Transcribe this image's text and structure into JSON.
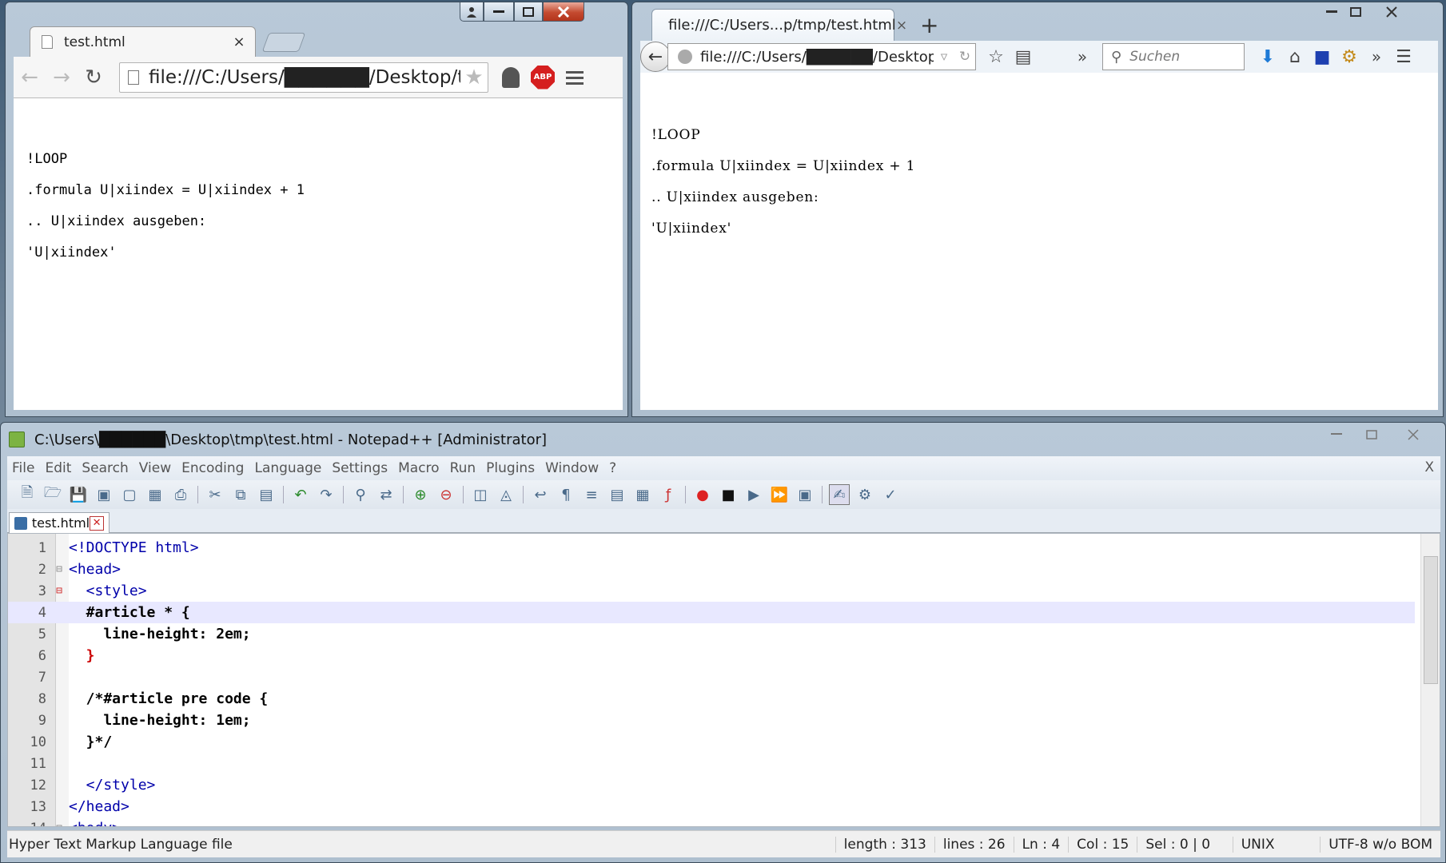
{
  "chrome": {
    "tab_title": "test.html",
    "tab_close": "×",
    "url": "file:///C:/Users/██████/Desktop/tmp",
    "abp_label": "ABP",
    "content_lines": [
      "!LOOP",
      ".formula U|xiindex = U|xiindex + 1",
      ".. U|xiindex ausgeben:",
      "'U|xiindex'"
    ]
  },
  "firefox": {
    "tab_title": "file:///C:/Users...p/tmp/test.html",
    "tab_close": "×",
    "new_tab": "+",
    "url": "file:///C:/Users/██████/Desktop/tm",
    "search_placeholder": "Suchen",
    "overflow": "»",
    "content_lines": [
      "!LOOP",
      ".formula U|xiindex = U|xiindex + 1",
      ".. U|xiindex ausgeben:",
      "'U|xiindex'"
    ]
  },
  "notepad": {
    "title": "C:\\Users\\██████\\Desktop\\tmp\\test.html - Notepad++ [Administrator]",
    "menu": [
      "File",
      "Edit",
      "Search",
      "View",
      "Encoding",
      "Language",
      "Settings",
      "Macro",
      "Run",
      "Plugins",
      "Window",
      "?"
    ],
    "menu_close": "X",
    "tab_title": "test.html",
    "code_lines": [
      {
        "n": "1",
        "text": "<!DOCTYPE html>"
      },
      {
        "n": "2",
        "text": "<head>"
      },
      {
        "n": "3",
        "text": "  <style>"
      },
      {
        "n": "4",
        "text": "  #article * {"
      },
      {
        "n": "5",
        "text": "    line-height: 2em;"
      },
      {
        "n": "6",
        "text": "  }"
      },
      {
        "n": "7",
        "text": ""
      },
      {
        "n": "8",
        "text": "  /*#article pre code {"
      },
      {
        "n": "9",
        "text": "    line-height: 1em;"
      },
      {
        "n": "10",
        "text": "  }*/"
      },
      {
        "n": "11",
        "text": ""
      },
      {
        "n": "12",
        "text": "  </style>"
      },
      {
        "n": "13",
        "text": "</head>"
      },
      {
        "n": "14",
        "text": "<body>"
      }
    ],
    "status": {
      "filetype": "Hyper Text Markup Language file",
      "length": "length : 313",
      "lines": "lines : 26",
      "ln": "Ln : 4",
      "col": "Col : 15",
      "sel": "Sel : 0 | 0",
      "eol": "UNIX",
      "encoding": "UTF-8 w/o BOM"
    }
  },
  "colors": {
    "tag": "#0000aa",
    "brace": "#cc0000",
    "active_line": "#e8e8ff",
    "comment_highlight": "#8ef0f0"
  }
}
